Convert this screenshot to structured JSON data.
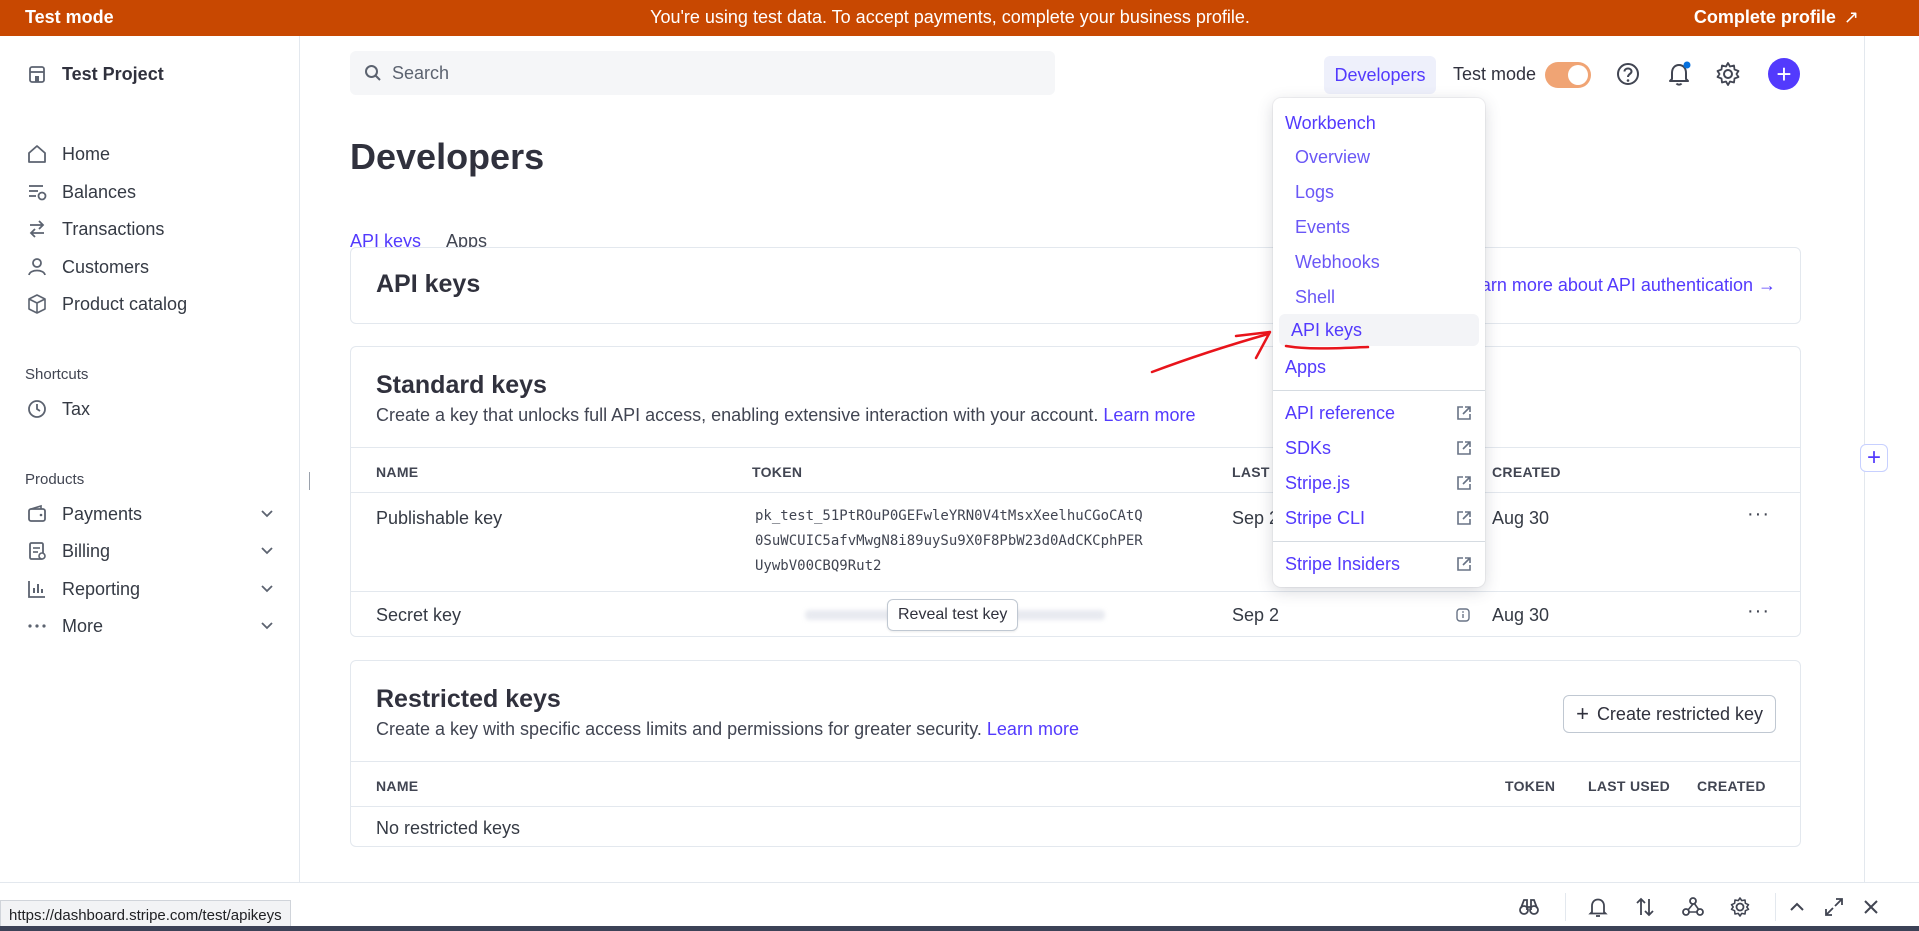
{
  "banner": {
    "mode": "Test mode",
    "message": "You're using test data. To accept payments, complete your business profile.",
    "cta": "Complete profile",
    "cta_icon": "arrow-up-right-icon"
  },
  "sidebar": {
    "project": "Test Project",
    "items": [
      {
        "label": "Home",
        "icon": "home-icon"
      },
      {
        "label": "Balances",
        "icon": "balances-icon"
      },
      {
        "label": "Transactions",
        "icon": "transactions-icon"
      },
      {
        "label": "Customers",
        "icon": "customers-icon"
      },
      {
        "label": "Product catalog",
        "icon": "product-catalog-icon"
      }
    ],
    "shortcuts_label": "Shortcuts",
    "shortcuts": [
      {
        "label": "Tax",
        "icon": "clock-icon"
      }
    ],
    "products_label": "Products",
    "products": [
      {
        "label": "Payments",
        "icon": "wallet-icon"
      },
      {
        "label": "Billing",
        "icon": "billing-icon"
      },
      {
        "label": "Reporting",
        "icon": "bar-chart-icon"
      },
      {
        "label": "More",
        "icon": "more-icon"
      }
    ]
  },
  "topbar": {
    "search_placeholder": "Search",
    "developers": "Developers",
    "test_mode_label": "Test mode",
    "test_mode_on": true
  },
  "page": {
    "title": "Developers",
    "tabs": [
      "API keys",
      "Apps"
    ],
    "active_tab": "API keys"
  },
  "api_keys_card": {
    "title": "API keys",
    "link": "arn more about API authentication →"
  },
  "standard_keys": {
    "title": "Standard keys",
    "desc": "Create a key that unlocks full API access, enabling extensive interaction with your account.",
    "learn_more": "Learn more",
    "columns": [
      "NAME",
      "TOKEN",
      "LAST U",
      "CREATED"
    ],
    "rows": [
      {
        "name": "Publishable key",
        "token_lines": [
          "pk_test_51PtROuP0GEFwleYRN0V4tMsxXeelhuCGoCAtQ",
          "0SuWCUIC5afvMwgN8i89uySu9X0F8PbW23d0AdCKCphPER",
          "UywbV00CBQ9Rut2"
        ],
        "last_used": "Sep 2",
        "created": "Aug 30"
      },
      {
        "name": "Secret key",
        "reveal": "Reveal test key",
        "last_used": "Sep 2",
        "created": "Aug 30"
      }
    ]
  },
  "restricted_keys": {
    "title": "Restricted keys",
    "desc": "Create a key with specific access limits and permissions for greater security.",
    "learn_more": "Learn more",
    "create_button": "Create restricted key",
    "columns": [
      "NAME",
      "TOKEN",
      "LAST USED",
      "CREATED"
    ],
    "empty": "No restricted keys"
  },
  "dropdown": {
    "workbench": "Workbench",
    "workbench_items": [
      "Overview",
      "Logs",
      "Events",
      "Webhooks",
      "Shell"
    ],
    "items": [
      "API keys",
      "Apps"
    ],
    "highlighted": "API keys",
    "external": [
      "API reference",
      "SDKs",
      "Stripe.js",
      "Stripe CLI"
    ],
    "insiders": "Stripe Insiders"
  },
  "status_url": "https://dashboard.stripe.com/test/apikeys",
  "colors": {
    "banner": "#c84801",
    "accent": "#533afd",
    "annotation": "#e8141b"
  }
}
